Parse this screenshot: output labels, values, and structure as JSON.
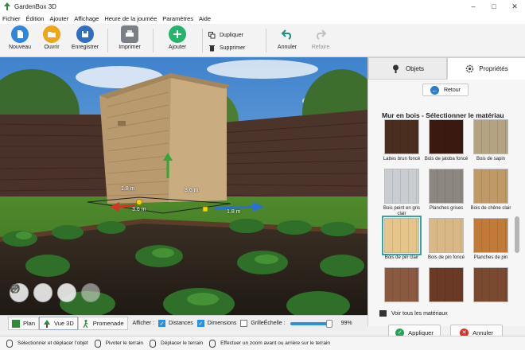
{
  "window": {
    "title": "GardenBox 3D"
  },
  "menu": [
    "Fichier",
    "Édition",
    "Ajouter",
    "Affichage",
    "Heure de la journée",
    "Paramètres",
    "Aide"
  ],
  "toolbar": {
    "new": "Nouveau",
    "open": "Ouvrir",
    "save": "Enregistrer",
    "print": "Imprimer",
    "add": "Ajouter",
    "duplicate": "Dupliquer",
    "delete": "Supprimer",
    "undo": "Annuler",
    "redo": "Refaire"
  },
  "viewport": {
    "measures": [
      "1.8 m",
      "3.6 m",
      "3.6 m",
      "1.8 m"
    ]
  },
  "panel": {
    "tab_objects": "Objets",
    "tab_properties": "Propriétés",
    "back": "Retour",
    "title": "Mur en bois - Sélectionner le matériau",
    "see_all": "Voir tous les matériaux",
    "apply": "Appliquer",
    "cancel": "Annuler",
    "materials": [
      {
        "name": "Lattes brun foncé",
        "color": "#4a2e20"
      },
      {
        "name": "Bois de jatoba foncé",
        "color": "#3a1a10"
      },
      {
        "name": "Bois de sapin",
        "color": "#b3a383"
      },
      {
        "name": "Bois peint en gris clair",
        "color": "#c9ccd0"
      },
      {
        "name": "Planches grises",
        "color": "#8c8780"
      },
      {
        "name": "Bois de chêne clair",
        "color": "#c09a66"
      },
      {
        "name": "Bois de pin clair",
        "color": "#e6c58a"
      },
      {
        "name": "Bois de pin foncé",
        "color": "#d9b888"
      },
      {
        "name": "Planches de pin",
        "color": "#c07a3a"
      },
      {
        "name": "",
        "color": "#8a5a40"
      },
      {
        "name": "",
        "color": "#6a3a26"
      },
      {
        "name": "",
        "color": "#7a4a30"
      }
    ]
  },
  "viewbar": {
    "plan": "Plan",
    "view3d": "Vue 3D",
    "walk": "Promenade",
    "show": "Afficher :",
    "distances": "Distances",
    "dimensions": "Dimensions",
    "grid": "Grille",
    "scale": "Échelle :",
    "zoom": "99%",
    "zoom_level": 0.99
  },
  "status": [
    "Sélectionner et déplacer l'objet",
    "Pivoter le terrain",
    "Déplacer le terrain",
    "Effectuer un zoom avant ou arrière sur le terrain"
  ]
}
